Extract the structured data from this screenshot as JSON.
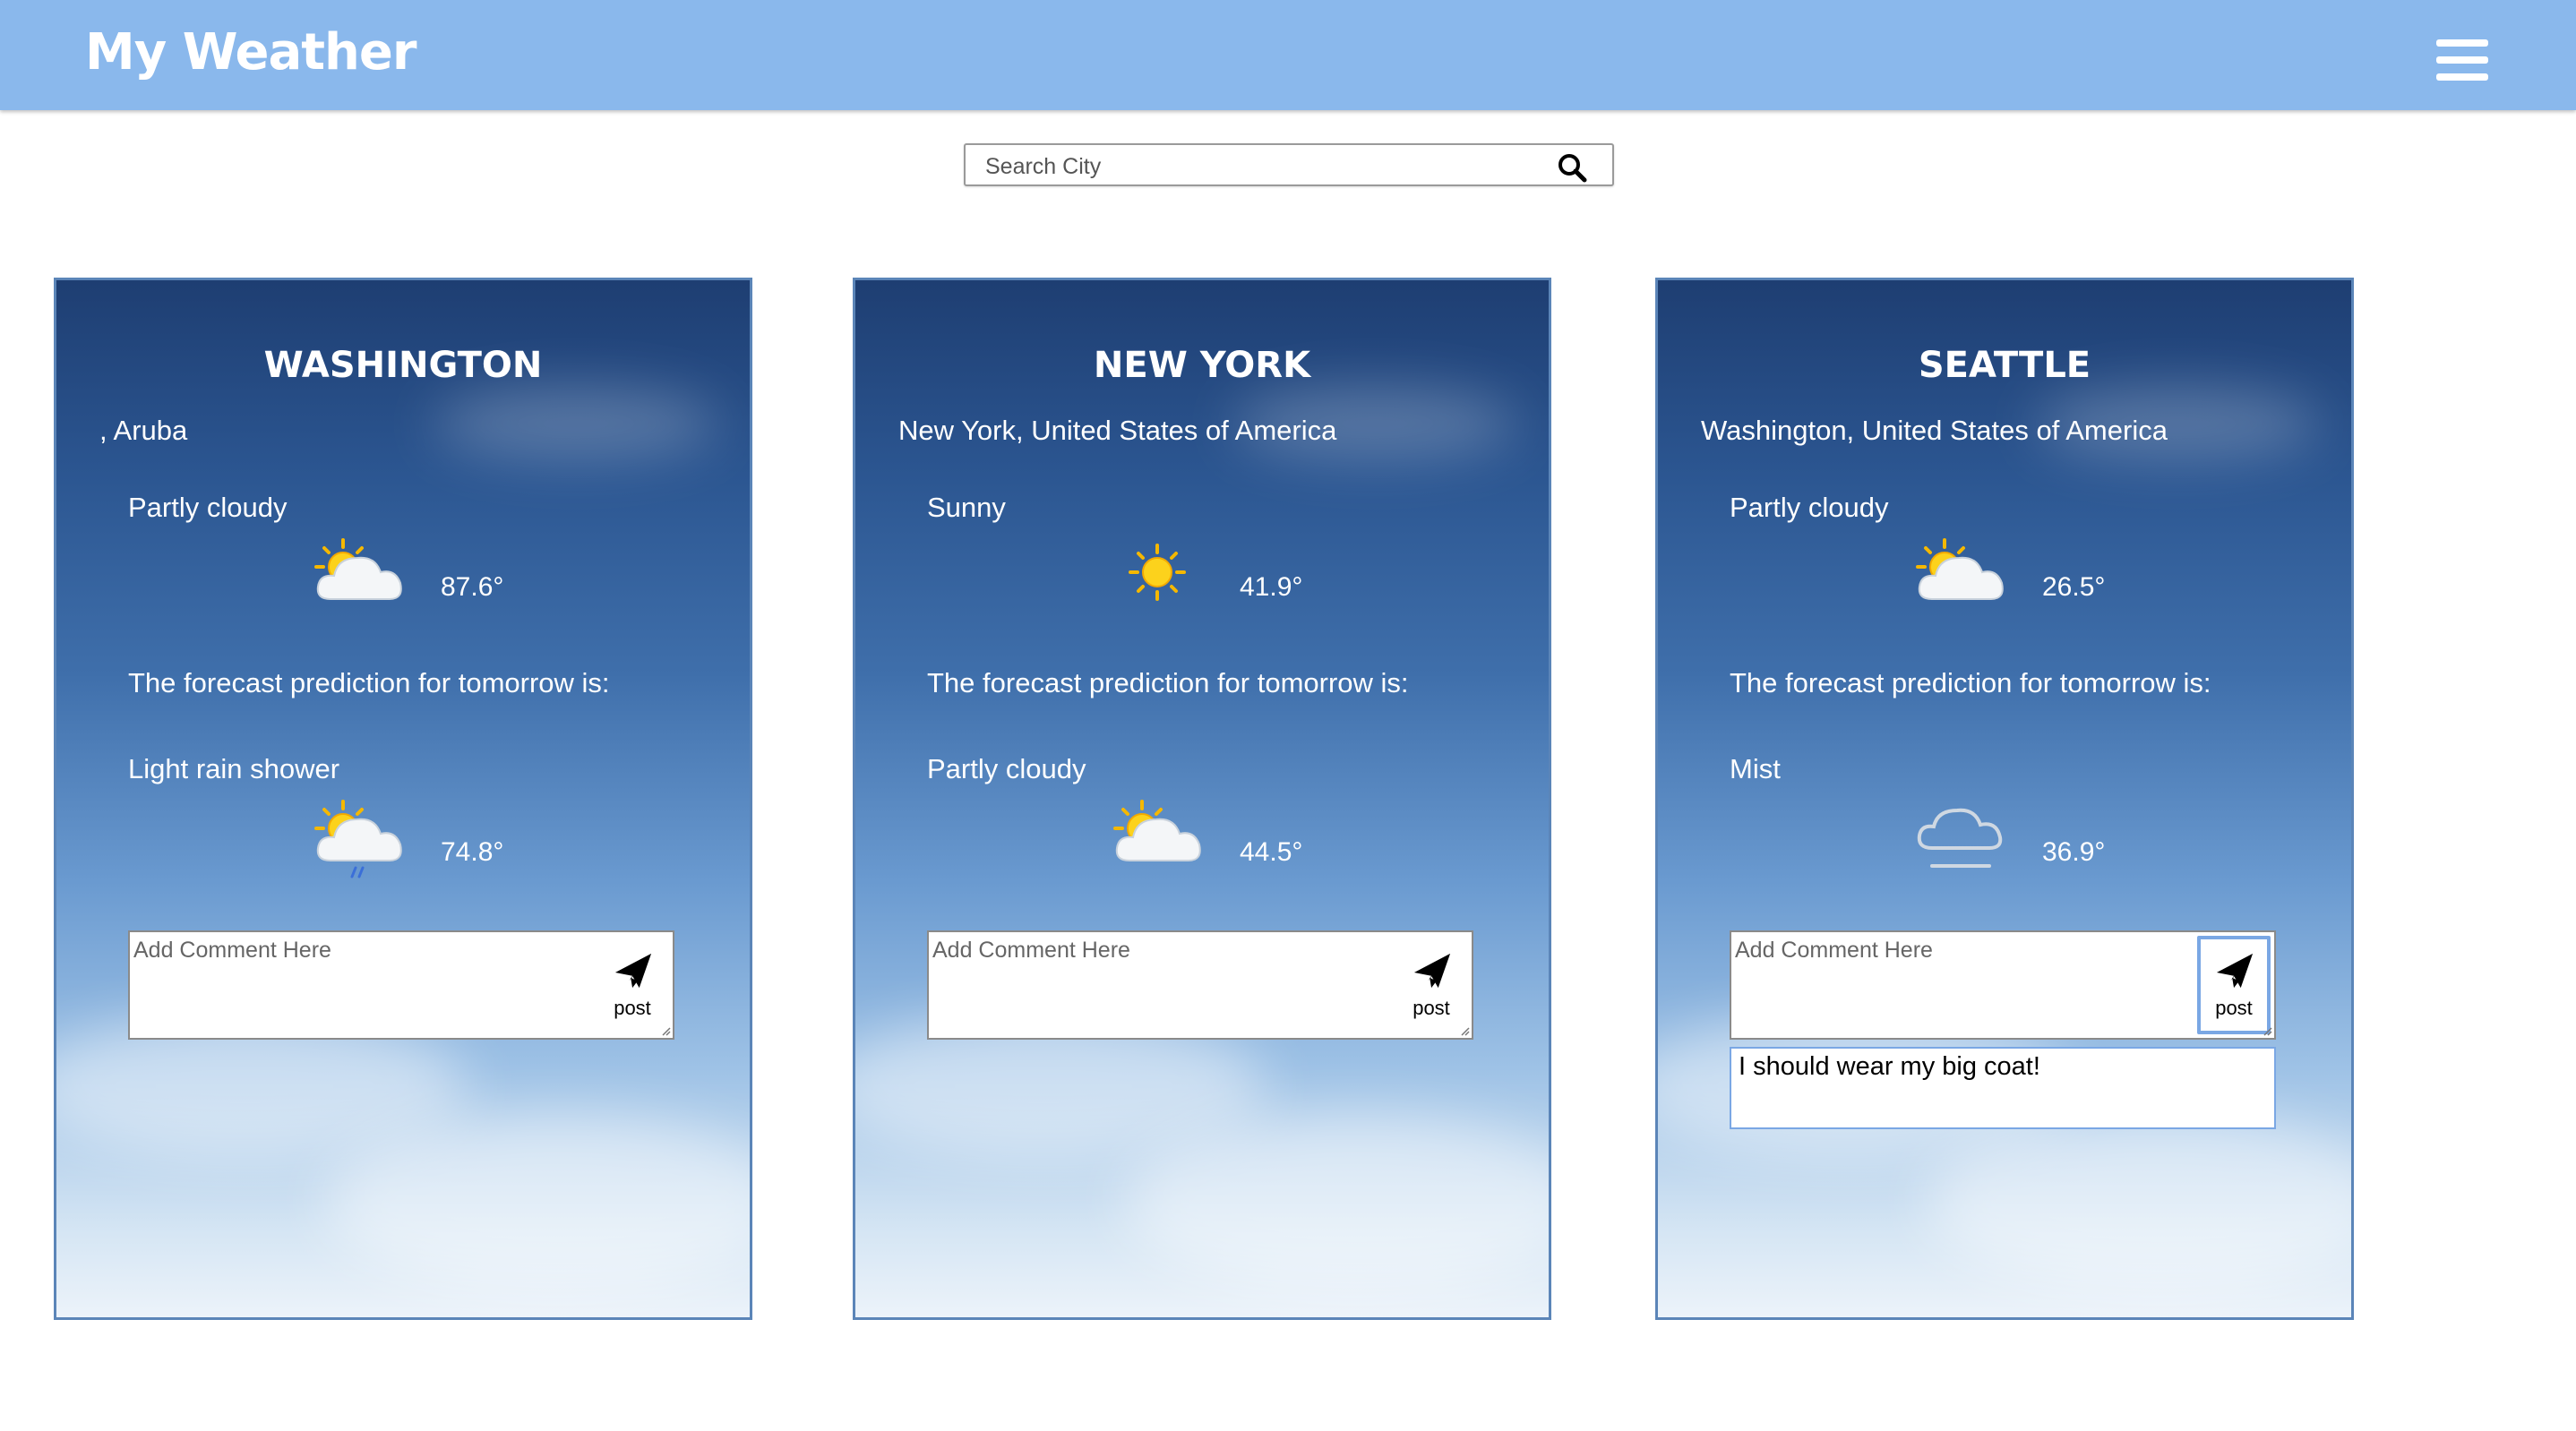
{
  "header": {
    "title": "My Weather"
  },
  "search": {
    "placeholder": "Search City"
  },
  "cards": [
    {
      "city": "WASHINGTON",
      "region": ", Aruba",
      "current": {
        "condition": "Partly cloudy",
        "temp": "87.6°",
        "icon": "partly-cloudy-icon"
      },
      "forecast_label": "The forecast prediction for tomorrow is:",
      "tomorrow": {
        "condition": "Light rain shower",
        "temp": "74.8°",
        "icon": "light-rain-shower-icon"
      },
      "comment": {
        "placeholder": "Add Comment Here",
        "post_label": "post"
      }
    },
    {
      "city": "NEW YORK",
      "region": "New York, United States of America",
      "current": {
        "condition": "Sunny",
        "temp": "41.9°",
        "icon": "sunny-icon"
      },
      "forecast_label": "The forecast prediction for tomorrow is:",
      "tomorrow": {
        "condition": "Partly cloudy",
        "temp": "44.5°",
        "icon": "partly-cloudy-icon"
      },
      "comment": {
        "placeholder": "Add Comment Here",
        "post_label": "post"
      }
    },
    {
      "city": "SEATTLE",
      "region": "Washington, United States of America",
      "current": {
        "condition": "Partly cloudy",
        "temp": "26.5°",
        "icon": "partly-cloudy-icon"
      },
      "forecast_label": "The forecast prediction for tomorrow is:",
      "tomorrow": {
        "condition": "Mist",
        "temp": "36.9°",
        "icon": "mist-icon"
      },
      "comment": {
        "placeholder": "Add Comment Here",
        "post_label": "post"
      },
      "posted_comments": [
        "I should wear my big coat!"
      ]
    }
  ],
  "colors": {
    "header_bg": "#8ab8ec",
    "card_border": "#5b85b8",
    "focus": "#7aa7e4"
  }
}
